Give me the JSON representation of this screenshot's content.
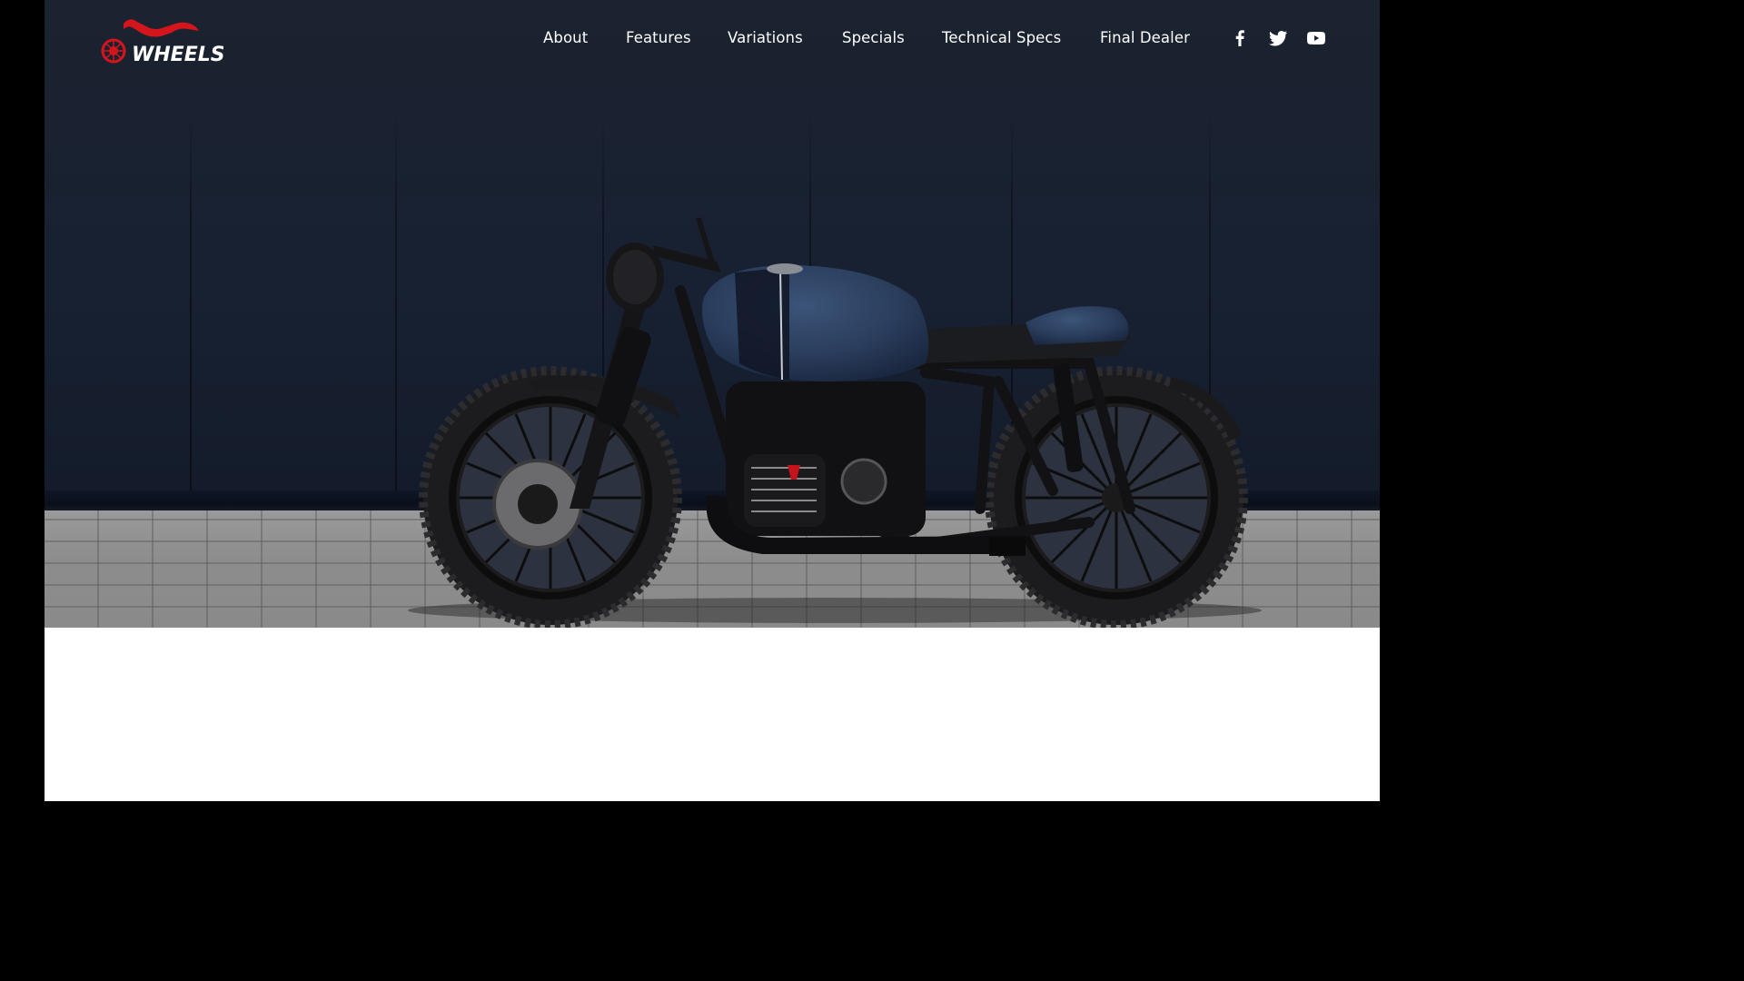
{
  "brand": {
    "name": "WHEELS",
    "accent_color": "#d4151c"
  },
  "nav": {
    "items": [
      {
        "label": "About"
      },
      {
        "label": "Features"
      },
      {
        "label": "Variations"
      },
      {
        "label": "Specials"
      },
      {
        "label": "Technical Specs"
      },
      {
        "label": "Final Dealer"
      }
    ]
  },
  "social": [
    {
      "icon": "facebook-icon"
    },
    {
      "icon": "twitter-icon"
    },
    {
      "icon": "youtube-icon"
    }
  ],
  "hero": {
    "image": "cafe-racer-motorcycle-photo"
  }
}
